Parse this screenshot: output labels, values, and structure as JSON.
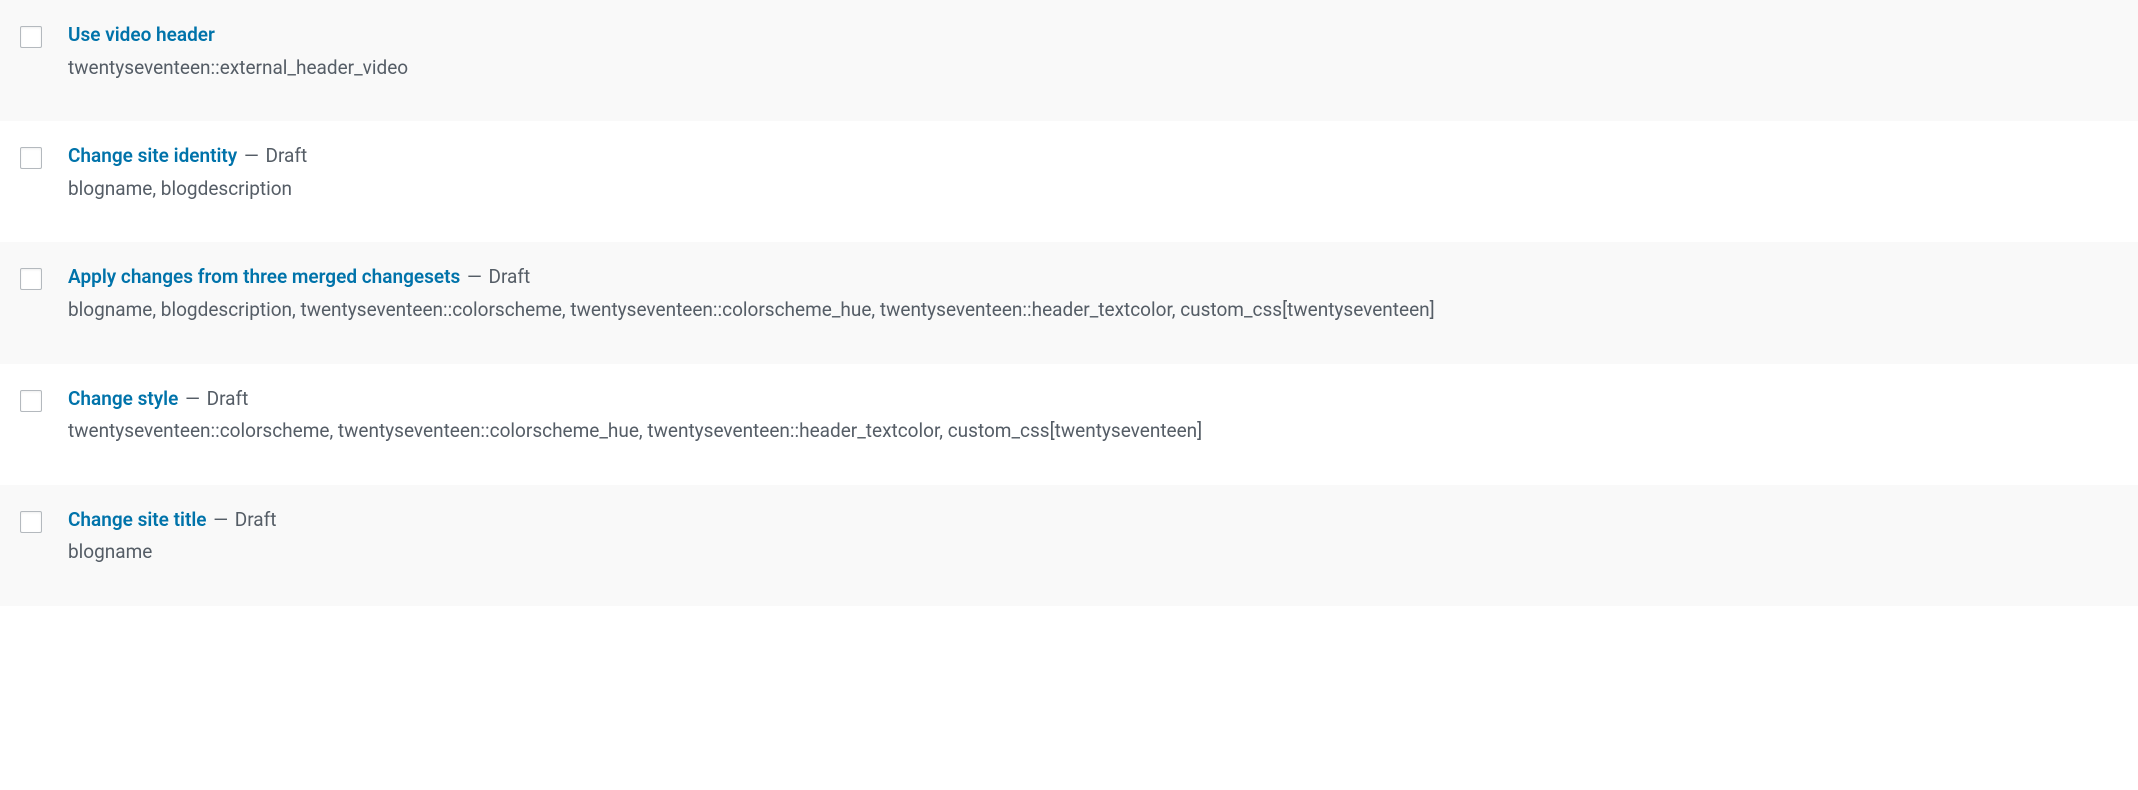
{
  "status_separator": " — ",
  "rows": [
    {
      "title": "Use video header",
      "status": "",
      "desc": "twentyseventeen::external_header_video",
      "alt": true
    },
    {
      "title": "Change site identity",
      "status": "Draft",
      "desc": "blogname, blogdescription",
      "alt": false
    },
    {
      "title": "Apply changes from three merged changesets",
      "status": "Draft",
      "desc": "blogname, blogdescription, twentyseventeen::colorscheme, twentyseventeen::colorscheme_hue, twentyseventeen::header_textcolor, custom_css[twentyseventeen]",
      "alt": true
    },
    {
      "title": "Change style",
      "status": "Draft",
      "desc": "twentyseventeen::colorscheme, twentyseventeen::colorscheme_hue, twentyseventeen::header_textcolor, custom_css[twentyseventeen]",
      "alt": false
    },
    {
      "title": "Change site title",
      "status": "Draft",
      "desc": "blogname",
      "alt": true
    }
  ]
}
